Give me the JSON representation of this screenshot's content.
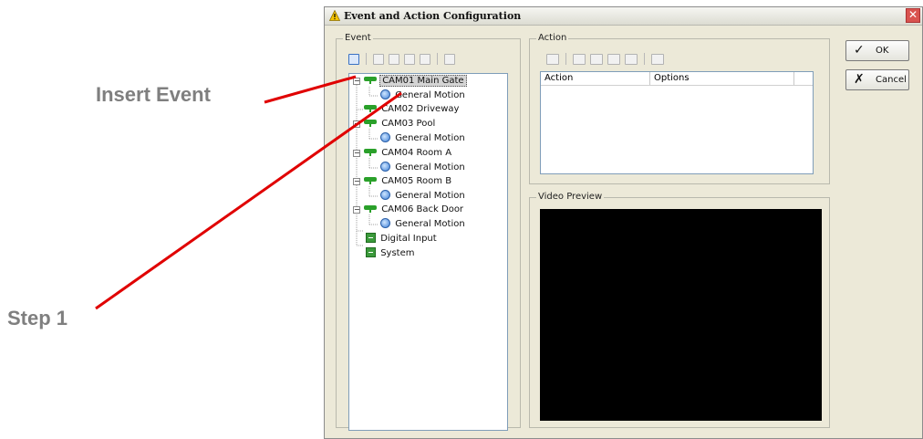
{
  "annotations": {
    "insert_event": "Insert Event",
    "step_1": "Step 1",
    "line_color": "#e00000"
  },
  "dialog": {
    "title": "Event and Action Configuration",
    "close_glyph": "✕"
  },
  "event_group": {
    "label": "Event",
    "toolbar": [
      "insert-event-icon",
      "delete-icon",
      "copy-icon",
      "paste-icon",
      "properties-icon",
      "export-icon"
    ],
    "tree": [
      {
        "label": "CAM01 Main Gate",
        "type": "camera",
        "selected": true
      },
      {
        "label": "General Motion",
        "type": "motion"
      },
      {
        "label": "CAM02 Driveway",
        "type": "camera"
      },
      {
        "label": "CAM03 Pool",
        "type": "camera"
      },
      {
        "label": "General Motion",
        "type": "motion"
      },
      {
        "label": "CAM04 Room A",
        "type": "camera"
      },
      {
        "label": "General Motion",
        "type": "motion"
      },
      {
        "label": "CAM05 Room B",
        "type": "camera"
      },
      {
        "label": "General Motion",
        "type": "motion"
      },
      {
        "label": "CAM06 Back Door",
        "type": "camera"
      },
      {
        "label": "General Motion",
        "type": "motion"
      },
      {
        "label": "Digital Input",
        "type": "io"
      },
      {
        "label": "System",
        "type": "io"
      }
    ]
  },
  "action_group": {
    "label": "Action",
    "toolbar": [
      "new-action-icon",
      "edit-action-icon",
      "copy-action-icon",
      "paste-action-icon",
      "move-action-icon",
      "test-action-icon"
    ],
    "columns": [
      "Action",
      "Options"
    ]
  },
  "preview_group": {
    "label": "Video Preview",
    "background": "#000000"
  },
  "buttons": {
    "ok": {
      "label": "OK",
      "icon": "✓"
    },
    "cancel": {
      "label": "Cancel",
      "icon": "✗"
    }
  },
  "colors": {
    "dialog_bg": "#ece9d8",
    "camera_icon": "#2aa02a",
    "selection_bg": "#d4d4d4"
  }
}
